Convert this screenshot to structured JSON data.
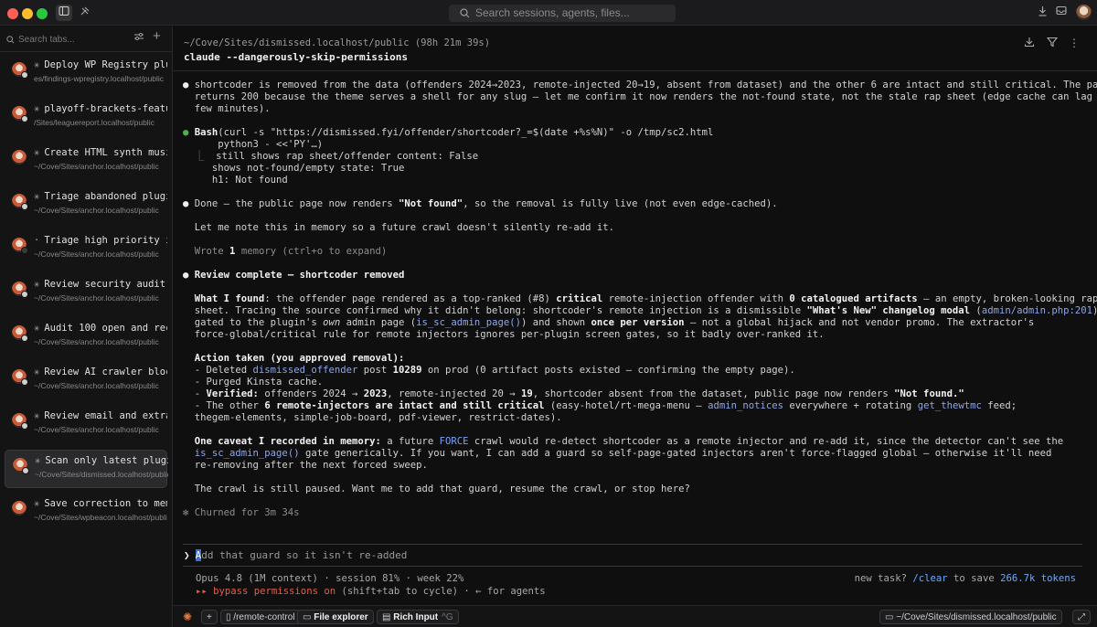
{
  "titlebar": {
    "search_placeholder": "Search sessions, agents, files..."
  },
  "sidebar": {
    "search_placeholder": "Search tabs...",
    "sessions": [
      {
        "title": "Deploy WP Registry plug",
        "path": "es/findings-wpregistry.localhost/public"
      },
      {
        "title": "playoff-brackets-featu",
        "path": "/Sites/leaguereport.localhost/public"
      },
      {
        "title": "Create HTML synth musi",
        "path": "~/Cove/Sites/anchor.localhost/public"
      },
      {
        "title": "Triage abandoned plugi",
        "path": "~/Cove/Sites/anchor.localhost/public"
      },
      {
        "title": "Triage high priority is",
        "path": "~/Cove/Sites/anchor.localhost/public"
      },
      {
        "title": "Review security audit",
        "path": "~/Cove/Sites/anchor.localhost/public"
      },
      {
        "title": "Audit 100 open and rec",
        "path": "~/Cove/Sites/anchor.localhost/public"
      },
      {
        "title": "Review AI crawler block",
        "path": "~/Cove/Sites/anchor.localhost/public"
      },
      {
        "title": "Review email and extra",
        "path": "~/Cove/Sites/anchor.localhost/public"
      },
      {
        "title": "Scan only latest plugi",
        "path": "~/Cove/Sites/dismissed.localhost/public"
      },
      {
        "title": "Save correction to mem",
        "path": "~/Cove/Sites/wpbeacon.localhost/public"
      }
    ]
  },
  "main": {
    "cwd": "~/Cove/Sites/dismissed.localhost/public (98h 21m 39s)",
    "command": "claude --dangerously-skip-permissions",
    "log": {
      "p1a": "shortcoder is removed from the data (offenders 2024→2023, remote-injected 20→19, absent from dataset) and the other 6 are intact and still critical. The page",
      "p1b": "returns 200 because the theme serves a shell for any slug — let me confirm it now renders the not-found state, not the stale rap sheet (edge cache can lag a",
      "p1c": "few minutes).",
      "bash_label": "Bash",
      "bash_cmd": "(curl -s \"https://dismissed.fyi/offender/shortcoder?_=$(date +%s%N)\" -o /tmp/sc2.html",
      "bash_cmd2": "python3 - <<'PY'…)",
      "out1": "still shows rap sheet/offender content: False",
      "out2": "shows not-found/empty state: True",
      "out3": "h1: Not found",
      "done_pre": "Done — the public page now renders ",
      "done_bold": "\"Not found\"",
      "done_post": ", so the removal is fully live (not even edge-cached).",
      "memory_note": "Let me note this in memory so a future crawl doesn't silently re-add it.",
      "wrote_pre": "Wrote ",
      "wrote_num": "1",
      "wrote_post": " memory (ctrl+o to expand)",
      "review_title": "Review complete — shortcoder removed",
      "found_label": "What I found",
      "found_1": ": the offender page rendered as a top-ranked (#8) ",
      "found_critical": "critical",
      "found_2": " remote-injection offender with ",
      "found_zero": "0 catalogued artifacts",
      "found_3": " — an empty, broken-looking rap",
      "found_l2a": "sheet. Tracing the source confirmed why it didn't belong: shortcoder's remote injection is a dismissible ",
      "found_whatsnew": "\"What's New\" changelog modal",
      "found_l2b": " (",
      "found_adminphp": "admin/admin.php:201",
      "found_l2c": "),",
      "found_l3a": "gated to the plugin's ",
      "found_own": "own",
      "found_l3b": " admin page (",
      "found_fn": "is_sc_admin_page()",
      "found_l3c": ") and shown ",
      "found_once": "once per version",
      "found_l3d": " — not a global hijack and not vendor promo. The extractor's",
      "found_l4": "force-global/critical rule for remote injectors ignores per-plugin screen gates, so it badly over-ranked it.",
      "action_title": "Action taken (you approved removal):",
      "act1a": "- Deleted ",
      "act1_code": "dismissed_offender",
      "act1b": " post ",
      "act1_num": "10289",
      "act1c": " on prod (0 artifact posts existed — confirming the empty page).",
      "act2": "- Purged Kinsta cache.",
      "act3_pre": "- ",
      "act3_verified": "Verified:",
      "act3a": " offenders 2024 → ",
      "act3_2023": "2023",
      "act3b": ", remote-injected 20 → ",
      "act3_19": "19",
      "act3c": ", shortcoder absent from the dataset, public page now renders ",
      "act3_nf": "\"Not found.\"",
      "act4a": "- The other ",
      "act4_bold": "6 remote-injectors are intact and still critical",
      "act4b": " (easy-hotel/rt-mega-menu — ",
      "act4_notices": "admin_notices",
      "act4c": " everywhere + rotating ",
      "act4_fn": "get_thewtmc",
      "act4d": " feed;",
      "act5": "thegem-elements, simple-job-board, pdf-viewer, restrict-dates).",
      "caveat_label": "One caveat I recorded in memory:",
      "cav1a": " a future ",
      "cav1_force": "FORCE",
      "cav1b": " crawl would re-detect shortcoder as a remote injector and re-add it, since the detector can't see the",
      "cav2_fn": "is_sc_admin_page()",
      "cav2a": " gate generically. If you want, I can add a guard so self-page-gated injectors aren't force-flagged global — otherwise it'll need",
      "cav3": "re-removing after the next forced sweep.",
      "closing": "The crawl is still paused. Want me to add that guard, resume the crawl, or stop here?",
      "churned": "✻ Churned for 3m 34s"
    },
    "prompt": {
      "first_char": "A",
      "rest": "dd that guard so it isn't re-added"
    },
    "status": {
      "model": "Opus 4.8 (1M context) · session 81% · week 22%",
      "newtask_pre": "new task? ",
      "newtask_cmd": "/clear",
      "newtask_mid": " to save ",
      "newtask_tokens": "266.7k tokens",
      "bypass_arrows": "▸▸ ",
      "bypass_label": "bypass permissions on",
      "bypass_rest": " (shift+tab to cycle) · ← for agents"
    },
    "bottombar": {
      "remote_control": "/remote-control",
      "file_explorer": "File explorer",
      "rich_input": "Rich Input",
      "rich_input_kbd": "^G",
      "path": "~/Cove/Sites/dismissed.localhost/public"
    }
  }
}
